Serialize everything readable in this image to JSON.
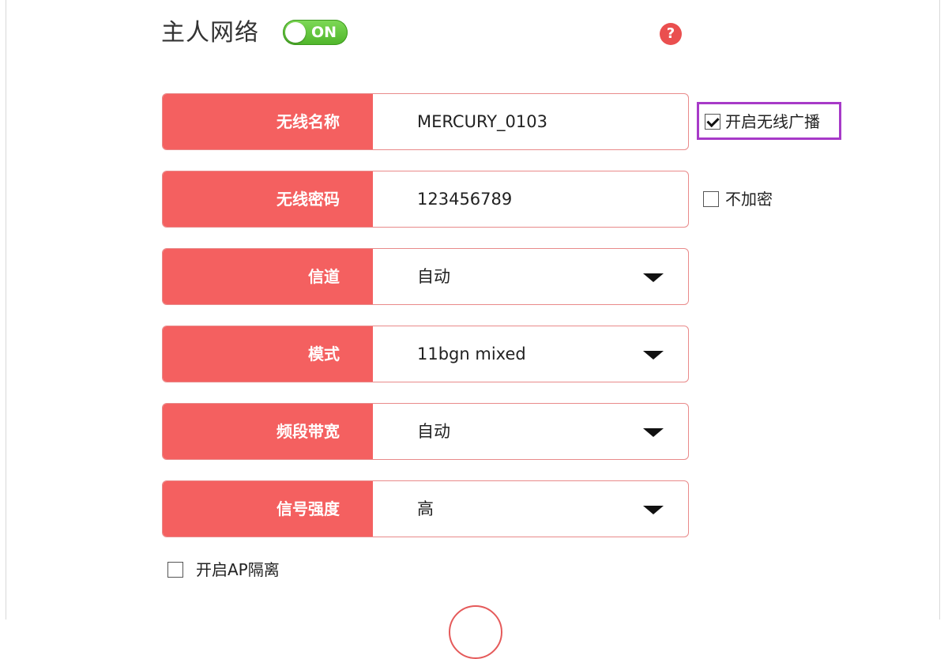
{
  "header": {
    "title": "主人网络",
    "toggle_label": "ON",
    "help_symbol": "?"
  },
  "form": {
    "rows": [
      {
        "label": "无线名称",
        "value": "MERCURY_0103",
        "type": "text"
      },
      {
        "label": "无线密码",
        "value": "123456789",
        "type": "text"
      },
      {
        "label": "信道",
        "value": "自动",
        "type": "select"
      },
      {
        "label": "模式",
        "value": "11bgn mixed",
        "type": "select"
      },
      {
        "label": "频段带宽",
        "value": "自动",
        "type": "select"
      },
      {
        "label": "信号强度",
        "value": "高",
        "type": "select"
      }
    ]
  },
  "options": {
    "broadcast": {
      "label": "开启无线广播",
      "checked": true
    },
    "no_encrypt": {
      "label": "不加密",
      "checked": false
    },
    "ap_isolation": {
      "label": "开启AP隔离",
      "checked": false
    }
  },
  "colors": {
    "label_bg": "#f46060",
    "toggle_on": "#5cc22f",
    "highlight": "#a73ac8",
    "help": "#ea4f4f"
  },
  "icons": {
    "help": "question-circle-icon",
    "dropdown": "caret-down-icon",
    "checkbox": "checkbox-icon"
  }
}
